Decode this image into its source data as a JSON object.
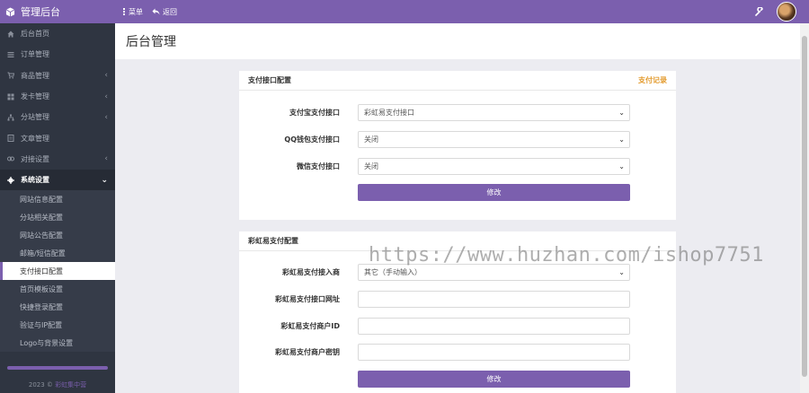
{
  "header": {
    "brand": "管理后台",
    "menu_label": "菜单",
    "back_label": "返回",
    "accent": "#7b5fae"
  },
  "sidebar": {
    "items": [
      {
        "label": "后台首页",
        "icon": "home-icon",
        "chevron": false
      },
      {
        "label": "订单管理",
        "icon": "list-icon",
        "chevron": false
      },
      {
        "label": "商品管理",
        "icon": "cart-icon",
        "chevron": true
      },
      {
        "label": "发卡管理",
        "icon": "grid-icon",
        "chevron": true
      },
      {
        "label": "分站管理",
        "icon": "sitemap-icon",
        "chevron": true
      },
      {
        "label": "文章管理",
        "icon": "doc-icon",
        "chevron": false
      },
      {
        "label": "对接设置",
        "icon": "link-icon",
        "chevron": true
      },
      {
        "label": "系统设置",
        "icon": "gear-icon",
        "chevron": true,
        "open": true
      }
    ],
    "subitems": [
      "网站信息配置",
      "分站相关配置",
      "网站公告配置",
      "邮箱/短信配置",
      "支付接口配置",
      "首页模板设置",
      "快捷登录配置",
      "验证与IP配置",
      "Logo与背景设置"
    ],
    "active_subitem_index": 4,
    "footer_year": "2023 ©",
    "footer_link": "彩虹集中营"
  },
  "page": {
    "title": "后台管理"
  },
  "pay_config": {
    "title": "支付接口配置",
    "records_link": "支付记录",
    "alipay_label": "支付宝支付接口",
    "alipay_value": "彩虹易支付接口",
    "qq_label": "QQ钱包支付接口",
    "qq_value": "关闭",
    "wechat_label": "微信支付接口",
    "wechat_value": "关闭",
    "submit_label": "修改"
  },
  "epay_config": {
    "title": "彩虹易支付配置",
    "provider_label": "彩虹易支付接入商",
    "provider_value": "其它（手动输入）",
    "url_label": "彩虹易支付接口网址",
    "url_value": "",
    "pid_label": "彩虹易支付商户ID",
    "pid_value": "",
    "key_label": "彩虹易支付商户密钥",
    "key_value": "",
    "submit_label": "修改"
  },
  "watermark": "https://www.huzhan.com/ishop7751"
}
